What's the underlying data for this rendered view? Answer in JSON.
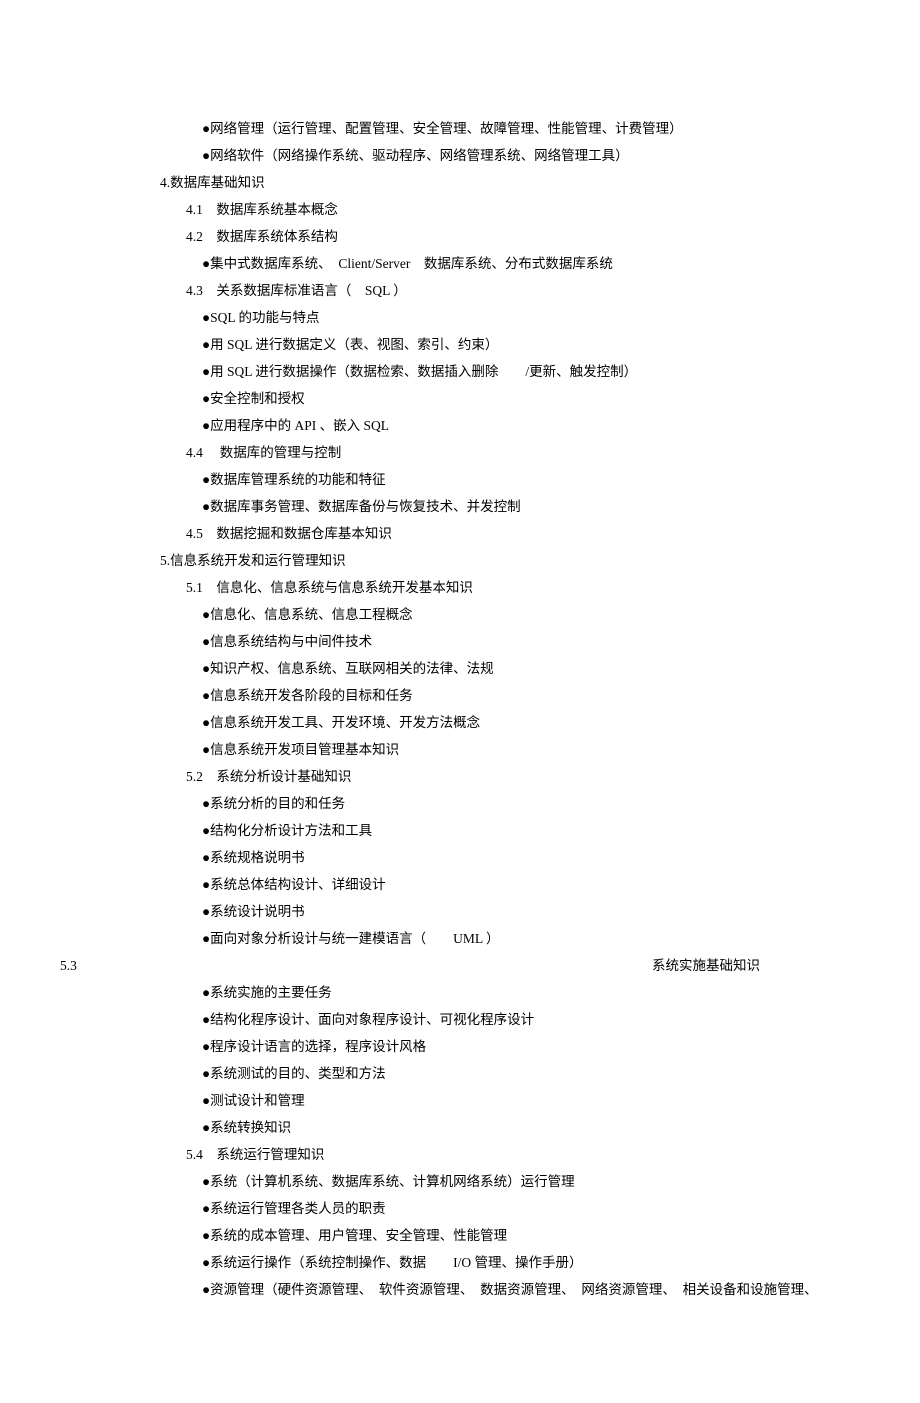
{
  "lines": [
    {
      "c": "l3",
      "t": "●网络管理（运行管理、配置管理、安全管理、故障管理、性能管理、计费管理）"
    },
    {
      "c": "l3",
      "t": "●网络软件（网络操作系统、驱动程序、网络管理系统、网络管理工具）"
    },
    {
      "c": "l1",
      "t": "4.数据库基础知识"
    },
    {
      "c": "l2",
      "t": "4.1　数据库系统基本概念"
    },
    {
      "c": "l2",
      "t": "4.2　数据库系统体系结构"
    },
    {
      "c": "l3",
      "t": "●集中式数据库系统、　Client/Server　数据库系统、分布式数据库系统"
    },
    {
      "c": "l2",
      "t": "4.3　关系数据库标准语言（　SQL ）"
    },
    {
      "c": "l3",
      "t": "●SQL 的功能与特点"
    },
    {
      "c": "l3",
      "t": "●用 SQL 进行数据定义（表、视图、索引、约束）"
    },
    {
      "c": "l3",
      "t": "●用 SQL 进行数据操作（数据检索、数据插入删除　　/更新、触发控制）"
    },
    {
      "c": "l3",
      "t": "●安全控制和授权"
    },
    {
      "c": "l3",
      "t": "●应用程序中的  API 、嵌入 SQL"
    },
    {
      "c": "l2",
      "t": "4.4　 数据库的管理与控制"
    },
    {
      "c": "l3",
      "t": "●数据库管理系统的功能和特征"
    },
    {
      "c": "l3",
      "t": "●数据库事务管理、数据库备份与恢复技术、并发控制"
    },
    {
      "c": "l2",
      "t": "4.5　数据挖掘和数据仓库基本知识"
    },
    {
      "c": "l1",
      "t": "5.信息系统开发和运行管理知识"
    },
    {
      "c": "l2",
      "t": "5.1　信息化、信息系统与信息系统开发基本知识"
    },
    {
      "c": "l3",
      "t": "●信息化、信息系统、信息工程概念"
    },
    {
      "c": "l3",
      "t": "●信息系统结构与中间件技术"
    },
    {
      "c": "l3",
      "t": "●知识产权、信息系统、互联网相关的法律、法规"
    },
    {
      "c": "l3",
      "t": "●信息系统开发各阶段的目标和任务"
    },
    {
      "c": "l3",
      "t": "●信息系统开发工具、开发环境、开发方法概念"
    },
    {
      "c": "l3",
      "t": "●信息系统开发项目管理基本知识"
    },
    {
      "c": "l2",
      "t": "5.2　系统分析设计基础知识"
    },
    {
      "c": "l3",
      "t": "●系统分析的目的和任务"
    },
    {
      "c": "l3",
      "t": "●结构化分析设计方法和工具"
    },
    {
      "c": "l3",
      "t": "●系统规格说明书"
    },
    {
      "c": "l3",
      "t": "●系统总体结构设计、详细设计"
    },
    {
      "c": "l3",
      "t": "●系统设计说明书"
    },
    {
      "c": "l3",
      "t": "●面向对象分析设计与统一建模语言（　　UML ）"
    },
    {
      "c": "weird",
      "left": "5.3",
      "right": "系统实施基础知识"
    },
    {
      "c": "l3",
      "t": "●系统实施的主要任务"
    },
    {
      "c": "l3",
      "t": "●结构化程序设计、面向对象程序设计、可视化程序设计"
    },
    {
      "c": "l3",
      "t": "●程序设计语言的选择，程序设计风格"
    },
    {
      "c": "l3",
      "t": "●系统测试的目的、类型和方法"
    },
    {
      "c": "l3",
      "t": "●测试设计和管理"
    },
    {
      "c": "l3",
      "t": "●系统转换知识"
    },
    {
      "c": "l2",
      "t": "5.4　系统运行管理知识"
    },
    {
      "c": "l3",
      "t": "●系统（计算机系统、数据库系统、计算机网络系统）运行管理"
    },
    {
      "c": "l3",
      "t": "●系统运行管理各类人员的职责"
    },
    {
      "c": "l3",
      "t": "●系统的成本管理、用户管理、安全管理、性能管理"
    },
    {
      "c": "l3",
      "t": "●系统运行操作（系统控制操作、数据　　I/O 管理、操作手册）"
    },
    {
      "c": "l3",
      "t": "●资源管理（硬件资源管理、　软件资源管理、　数据资源管理、　网络资源管理、　相关设备和设施管理、"
    }
  ]
}
